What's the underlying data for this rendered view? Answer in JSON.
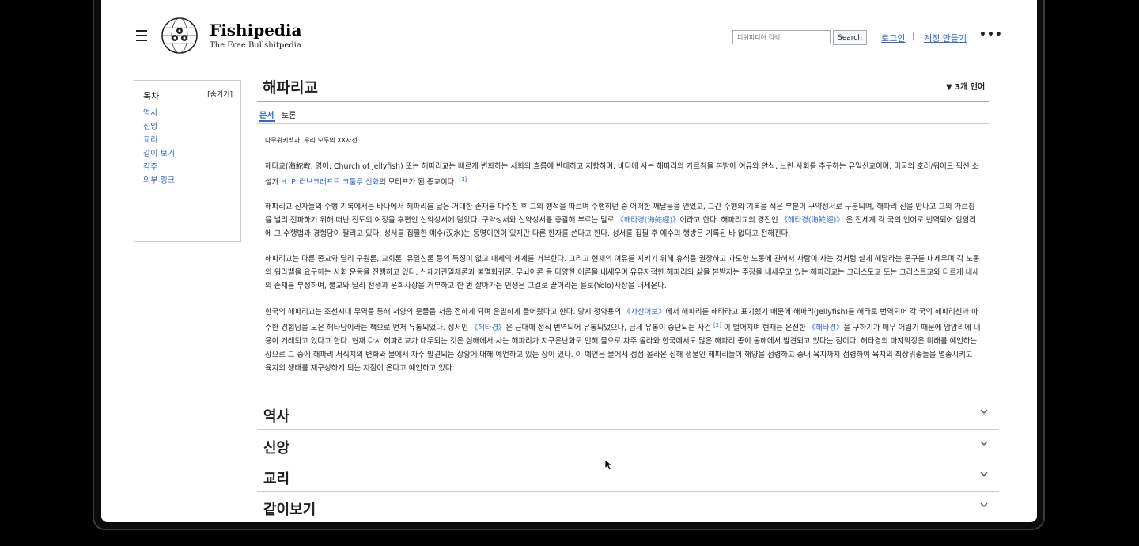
{
  "header": {
    "site_title": "Fishipedia",
    "site_subtitle": "The Free Bullshitpedia",
    "search_placeholder": "피쉬피디아 검색",
    "search_button": "Search",
    "login": "로그인",
    "separator": "|",
    "create_account": "계정 만들기",
    "more": "•••"
  },
  "toc": {
    "title": "목차",
    "hide": "[숨기기]",
    "items": [
      "역사",
      "신앙",
      "교리",
      "같이 보기",
      "각주",
      "외부 링크"
    ]
  },
  "article": {
    "title": "해파리교",
    "languages": "▼ 3개 언어",
    "tab_article": "문서",
    "tab_talk": "토론",
    "tagline": "나무위키백과, 우리 모두의 XX사전",
    "p1": {
      "a": "해타교(海鮀教, 영어: Church of jellyfish) 또는 해파리교는 빠르게 변화하는 사회의 흐름에 반대하고 저항하며, 바다에 사는 해파리의 가르침을 본받아 여유와 안식, 느린 사회를 추구하는 유일신교이며, 미국의 호러/워어드 픽션 소설가",
      "link": "H. P. 러브크래프트 크툴루 신화",
      "b": "의 모티프가 된 종교이다.",
      "ref": "[1]"
    },
    "p2": {
      "a": "해파리교 신자들의 수행 기록에서는 바다에서 해파리를 닮은 거대한 존재를 마주친 후 그의 행적을 따르며 수행하던 중 어떠한 깨달음을 얻었고, 그간 수행의 기록을 적은 부분이 구약성서로 구분되며, 해파리 신을 만나고 그의 가르침을 널리 전파하기 위해 떠난 전도의 여정을 후편인 신약성서에 담았다. 구약성서와 신약성서를 총괄해 부르는 말로",
      "link1": "《해타경(海鮀經)》",
      "b": "이라고 한다. 해파리교의 경전인",
      "link2": "《해타경(海鮀經)》",
      "c": "은 전세계 각 국의 언어로 번역되어 암암리에 그 수행법과 경험담이 팔리고 있다. 성서를 집필한 예수(汉水)는 동명이인이 있지만 다른 한자를 쓴다고 한다. 성서를 집필 후 예수의 행방은 기록된 바 없다고 전해진다."
    },
    "p3": "해파리교는 다른 종교와 달리 구원론, 교회론, 유일신론 등의 특징이 없고 내세의 세계를 거부한다. 그리고 현재의 여유를 지키기 위해 휴식을 권장하고 과도한 노동에 관해서 사람이 사는 것처럼 살게 해달라는 문구를 내세우며 각 노동의 워라밸을 요구하는 사회 운동을 진행하고 있다. 신체기관일체론과 불멸회귀론, 무뇌이론 등 다양한 이론을 내세우며 유유자적한 해파리의 삶을 본받자는 주장을 내세우고 있는 해파리교는 그리스도교 또는 크리스트교와 다르게 내세의 존재를 부정하며, 불교와 달리 전생과 윤회사상을 거부하고 한 번 살아가는 인생은 그걸로 끝이라는 욜로(Yolo)사상을 내세운다.",
    "p4": {
      "a": "한국의 해파리교는 조선시대 무역을 통해 서양의 문물을 처음 접하게 되며 은밀하게 들어왔다고 한다. 당시 정약용의",
      "link1": "《자산어보》",
      "b": "에서 해파리를 해타라고 표기했기 때문에 해파리(Jellyfish)를 해타로 번역되어 각 국의 해파리신과 마주한 경험담을 모은 해타담이라는 책으로 먼저 유통되었다. 성서인",
      "link2": "《해타경》",
      "c": "은 근대에 정식 번역되어 유통되었으나, 금세 유통이 중단되는 사건",
      "ref": "[2]",
      "d": "이 벌어지며 현재는 온전한",
      "link3": "《해타경》",
      "e": "을 구하기가 매우 어렵기 때문에 암암리에 내용이 거래되고 있다고 한다. 현재 다시 해파리교가 대두되는 것은 심해에서 사는 해파리가 지구온난화로 인해 물으로 자주 올라와 한국에서도 많은 해파리 종이 동해에서 발견되고 있다는 점이다. 해타경의 마지막장은 미래를 예언하는 장으로 그 중에 해파리 서식지의 변화와 물에서 자주 발견되는 상황에 대해 예언하고 있는 장이 있다. 이 예언은 물에서 점점 올라온 심해 생물인 해파리들이 해양을 점령하고 종내 육지까지 점령하여 육지의 최상위종들을 멸종시키고 육지의 생태를 재구성하게 되는 지점이 온다고 예언하고 있다."
    }
  },
  "sections": [
    "역사",
    "신앙",
    "교리",
    "같이보기"
  ]
}
